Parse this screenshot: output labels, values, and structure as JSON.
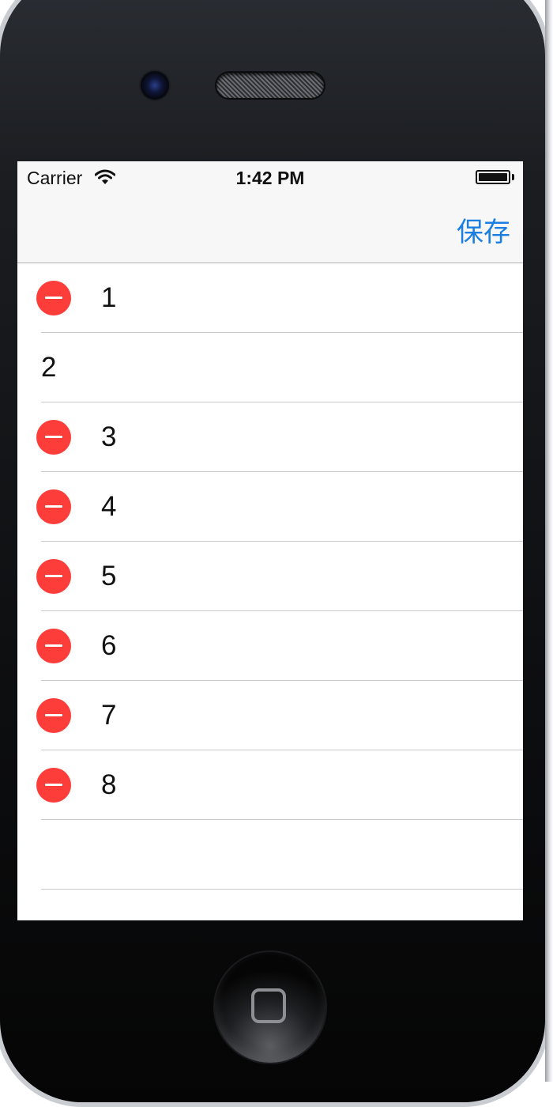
{
  "status_bar": {
    "carrier": "Carrier",
    "time": "1:42 PM"
  },
  "nav_bar": {
    "save_label": "保存"
  },
  "rows": [
    {
      "label": "1",
      "deletable": true
    },
    {
      "label": "2",
      "deletable": false
    },
    {
      "label": "3",
      "deletable": true
    },
    {
      "label": "4",
      "deletable": true
    },
    {
      "label": "5",
      "deletable": true
    },
    {
      "label": "6",
      "deletable": true
    },
    {
      "label": "7",
      "deletable": true
    },
    {
      "label": "8",
      "deletable": true
    },
    {
      "label": "",
      "deletable": false
    }
  ],
  "colors": {
    "accent": "#1a7fe0",
    "delete": "#fc3d39",
    "separator": "#c8c7cc",
    "bar_background": "#f7f7f7"
  },
  "icons": {
    "wifi": "wifi-icon",
    "battery": "battery-icon",
    "delete": "minus-circle-icon",
    "camera": "camera-icon",
    "speaker": "speaker-icon",
    "home": "home-button-icon"
  }
}
